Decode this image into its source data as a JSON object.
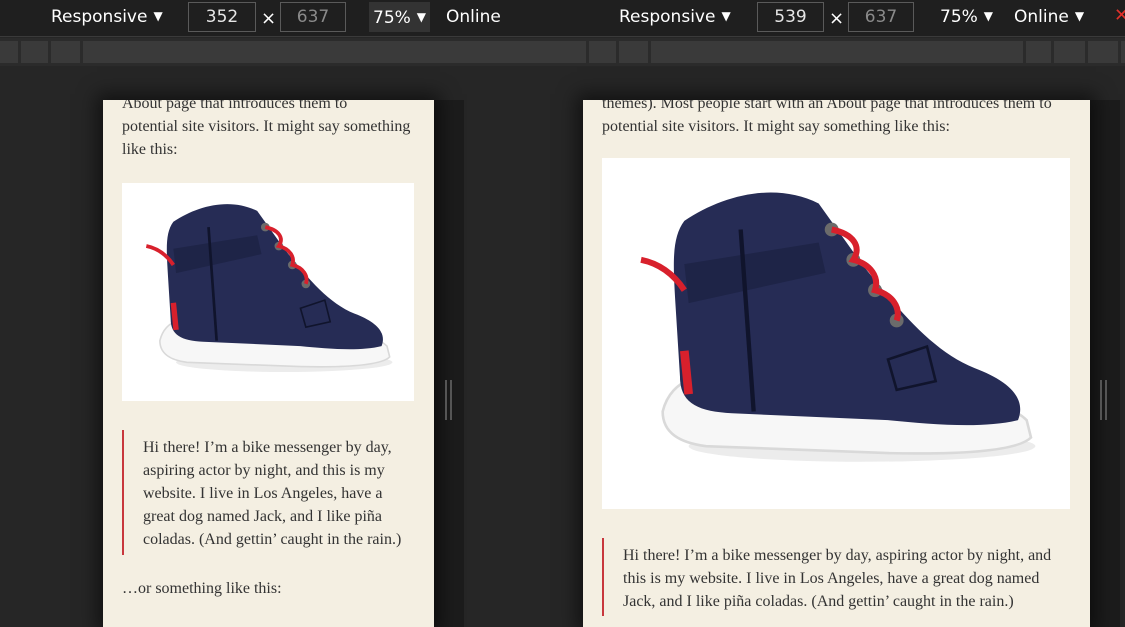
{
  "left_view": {
    "device": "Responsive",
    "width": "352",
    "height": "637",
    "zoom": "75%",
    "throttle": "Online",
    "intro_lines": [
      "About page that introduces them to",
      "potential site visitors. It might say something",
      "like this:"
    ],
    "quote_lines": [
      "Hi there! I’m a bike messenger by day,",
      "aspiring actor by night, and this is my",
      "website. I live in Los Angeles, have a",
      "great dog named Jack, and I like piña",
      "coladas. (And gettin’ caught in the rain.)"
    ],
    "outro": "…or something like this:"
  },
  "right_view": {
    "device": "Responsive",
    "width": "539",
    "height": "637",
    "zoom": "75%",
    "throttle": "Online",
    "intro_lines": [
      "themes). Most people start with an About page that introduces them to",
      "potential site visitors. It might say something like this:"
    ],
    "quote_lines": [
      "Hi there! I’m a bike messenger by day, aspiring actor by night, and",
      "this is my website. I live in Los Angeles, have a great dog named",
      "Jack, and I like piña coladas. (And gettin’ caught in the rain.)"
    ]
  },
  "symbols": {
    "times": "×",
    "arrow": "▼",
    "close": "✕"
  },
  "colors": {
    "page_bg": "#f4efe2",
    "quote_border": "#c8373d",
    "shoe_navy": "#262c55",
    "lace_red": "#d8202c"
  }
}
